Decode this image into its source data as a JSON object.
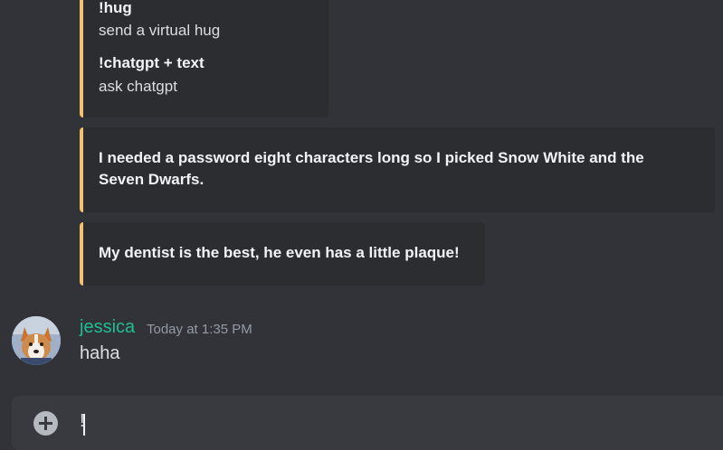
{
  "help_embed": {
    "commands": [
      {
        "name": "!hug",
        "desc": "send a virtual hug"
      },
      {
        "name": "!chatgpt + text",
        "desc": "ask chatgpt"
      }
    ]
  },
  "jokes": [
    {
      "line1": "I needed a password eight characters long so I picked Snow White and the",
      "line2": "Seven Dwarfs."
    },
    {
      "line1": "My dentist is the best, he even has a little plaque!"
    }
  ],
  "message": {
    "username": "jessica",
    "timestamp": "Today at 1:35 PM",
    "text": "haha"
  },
  "composer": {
    "value": "!"
  },
  "colors": {
    "embed_border": "#f0c36f",
    "username": "#1fbf93",
    "background": "#313338"
  }
}
